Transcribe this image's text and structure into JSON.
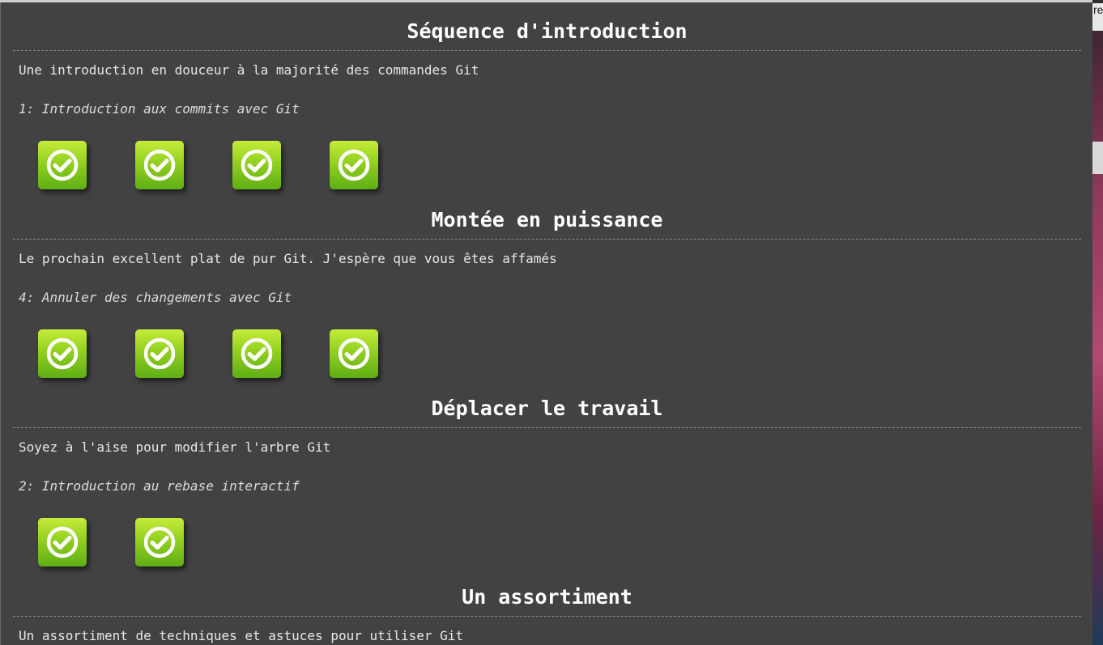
{
  "sequences": [
    {
      "title": "Séquence d'introduction",
      "description": "Une introduction en douceur à la majorité des commandes Git",
      "current_level": "1: Introduction aux commits avec Git",
      "levels_completed": 4
    },
    {
      "title": "Montée en puissance",
      "description": "Le prochain excellent plat de pur Git. J'espère que vous êtes affamés",
      "current_level": "4: Annuler des changements avec Git",
      "levels_completed": 4
    },
    {
      "title": "Déplacer le travail",
      "description": "Soyez à l'aise pour modifier l'arbre Git",
      "current_level": "2: Introduction au rebase interactif",
      "levels_completed": 2
    },
    {
      "title": "Un assortiment",
      "description": "Un assortiment de techniques et astuces pour utiliser Git"
    }
  ],
  "icons": {
    "level": "check-circle-icon"
  },
  "colors": {
    "background": "#424242",
    "icon_green_top": "#c5ec3a",
    "icon_green_bottom": "#5fae15",
    "title_text": "#ffffff"
  },
  "background_peek": {
    "top_text": "re"
  }
}
